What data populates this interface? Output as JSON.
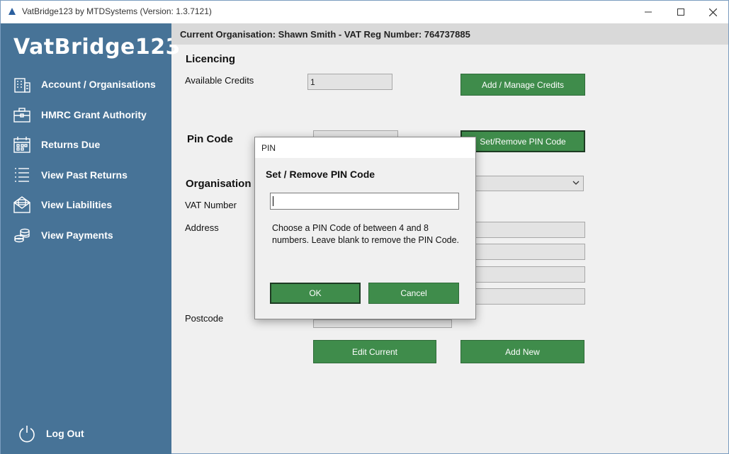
{
  "window": {
    "title": "VatBridge123 by MTDSystems (Version: 1.3.7121)",
    "controls": {
      "minimize": "minimize",
      "maximize": "maximize",
      "close": "close"
    }
  },
  "sidebar": {
    "brand": "VatBridge123",
    "items": [
      {
        "label": "Account / Organisations",
        "icon": "building-icon"
      },
      {
        "label": "HMRC Grant Authority",
        "icon": "briefcase-icon"
      },
      {
        "label": "Returns Due",
        "icon": "calendar-icon"
      },
      {
        "label": "View Past Returns",
        "icon": "list-icon"
      },
      {
        "label": "View Liabilities",
        "icon": "envelope-icon"
      },
      {
        "label": "View Payments",
        "icon": "coins-icon"
      }
    ],
    "logout": "Log Out"
  },
  "header": {
    "current_org": "Current Organisation: Shawn Smith - VAT Reg Number: 764737885"
  },
  "licencing": {
    "title": "Licencing",
    "credits_label": "Available Credits",
    "credits_value": "1",
    "manage_button": "Add / Manage Credits"
  },
  "pin": {
    "title": "Pin Code",
    "button": "Set/Remove PIN Code"
  },
  "organisation": {
    "title": "Organisation",
    "vat_label": "VAT Number",
    "address_label": "Address",
    "postcode_label": "Postcode",
    "edit_button": "Edit Current",
    "add_button": "Add New"
  },
  "modal": {
    "title": "PIN",
    "heading": "Set / Remove PIN Code",
    "input_value": "",
    "help": "Choose a PIN Code of between 4 and 8 numbers.  Leave blank to remove the PIN Code.",
    "ok": "OK",
    "cancel": "Cancel"
  },
  "colors": {
    "sidebar": "#477397",
    "button_green": "#3f8c4b",
    "header_strip": "#d9d9d9"
  }
}
